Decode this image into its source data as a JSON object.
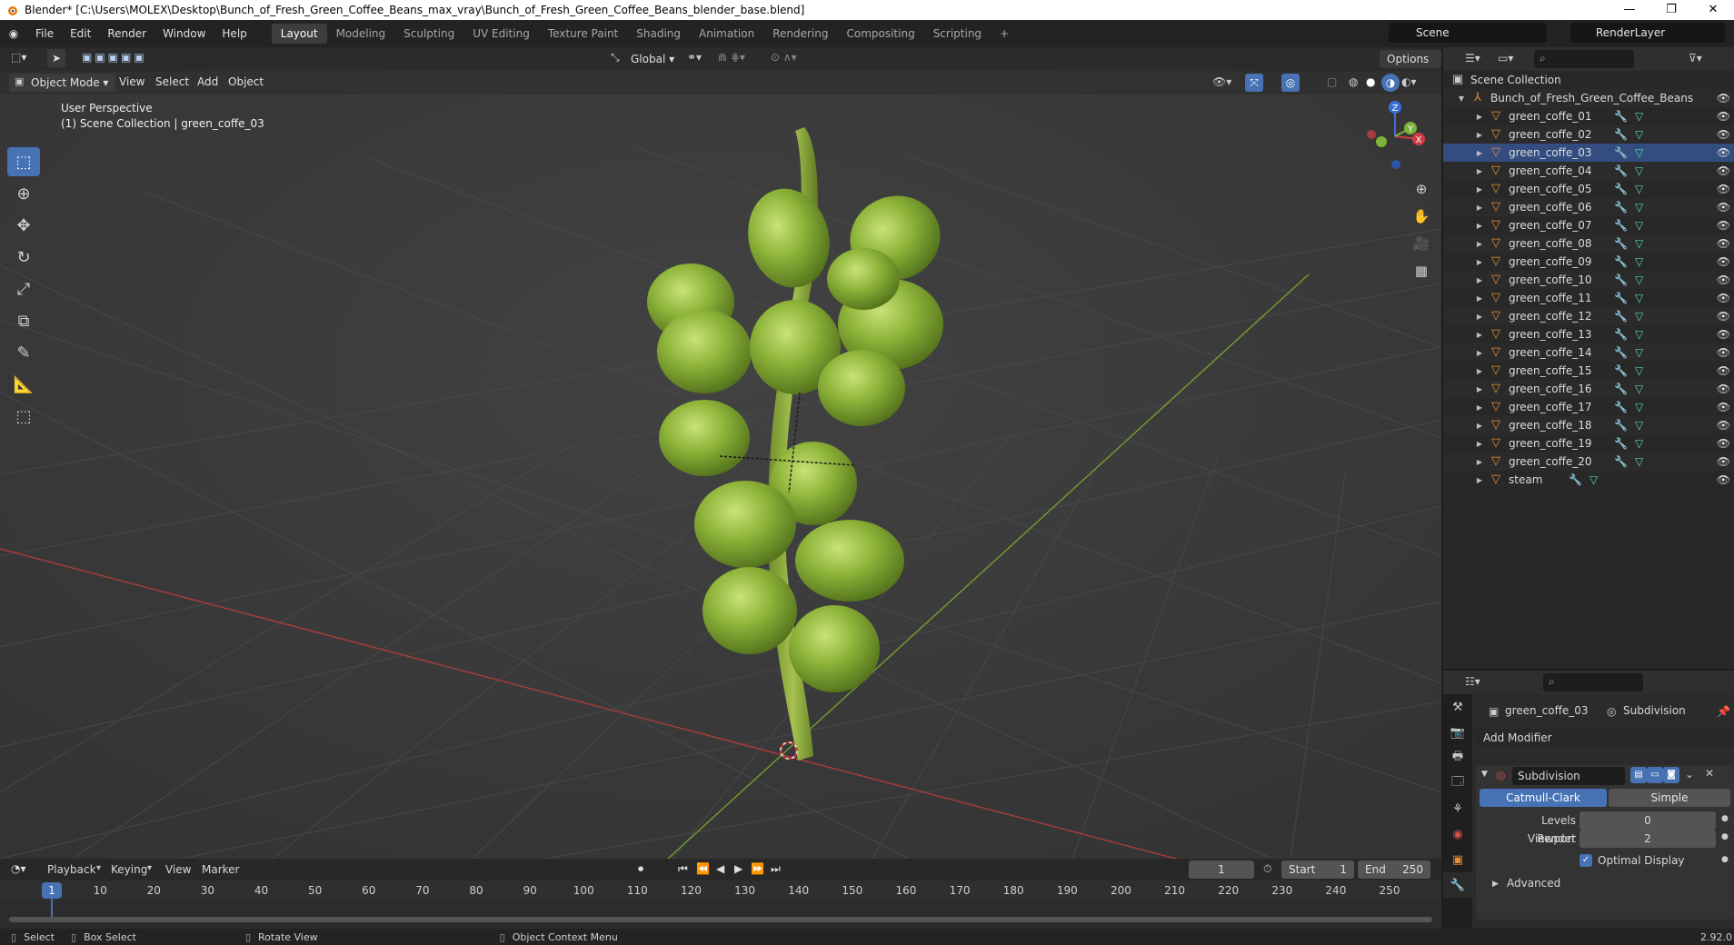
{
  "window": {
    "title": "Blender* [C:\\Users\\MOLEX\\Desktop\\Bunch_of_Fresh_Green_Coffee_Beans_max_vray\\Bunch_of_Fresh_Green_Coffee_Beans_blender_base.blend]",
    "controls": [
      "—",
      "❐",
      "✕"
    ]
  },
  "menu": [
    "File",
    "Edit",
    "Render",
    "Window",
    "Help"
  ],
  "workspaces": [
    "Layout",
    "Modeling",
    "Sculpting",
    "UV Editing",
    "Texture Paint",
    "Shading",
    "Animation",
    "Rendering",
    "Compositing",
    "Scripting"
  ],
  "active_workspace": "Layout",
  "scene": "Scene",
  "render_layer": "RenderLayer",
  "viewport": {
    "transform_orientation": "Global",
    "options_label": "Options",
    "mode": "Object Mode",
    "menus": [
      "View",
      "Select",
      "Add",
      "Object"
    ],
    "info_line1": "User Perspective",
    "info_line2": "(1) Scene Collection | green_coffe_03",
    "gizmo_axes": {
      "x": "X",
      "y": "Y",
      "z": "Z"
    }
  },
  "outliner": {
    "root": "Scene Collection",
    "collection": "Bunch_of_Fresh_Green_Coffee_Beans",
    "items": [
      "green_coffe_01",
      "green_coffe_02",
      "green_coffe_03",
      "green_coffe_04",
      "green_coffe_05",
      "green_coffe_06",
      "green_coffe_07",
      "green_coffe_08",
      "green_coffe_09",
      "green_coffe_10",
      "green_coffe_11",
      "green_coffe_12",
      "green_coffe_13",
      "green_coffe_14",
      "green_coffe_15",
      "green_coffe_16",
      "green_coffe_17",
      "green_coffe_18",
      "green_coffe_19",
      "green_coffe_20",
      "steam"
    ],
    "selected": "green_coffe_03"
  },
  "properties": {
    "object_name": "green_coffe_03",
    "modifier_breadcrumb": "Subdivision",
    "add_modifier": "Add Modifier",
    "modifier_name": "Subdivision",
    "subdiv_types": [
      "Catmull-Clark",
      "Simple"
    ],
    "active_subdiv_type": "Catmull-Clark",
    "levels_viewport_label": "Levels Viewport",
    "levels_viewport": "0",
    "render_label": "Render",
    "render_value": "2",
    "optimal_display_label": "Optimal Display",
    "optimal_display": true,
    "advanced_label": "Advanced"
  },
  "timeline": {
    "menus": [
      "Playback",
      "Keying",
      "View",
      "Marker"
    ],
    "current_frame": "1",
    "start_label": "Start",
    "start": "1",
    "end_label": "End",
    "end": "250",
    "ticks": [
      "1",
      "10",
      "20",
      "30",
      "40",
      "50",
      "60",
      "70",
      "80",
      "90",
      "100",
      "110",
      "120",
      "130",
      "140",
      "150",
      "160",
      "170",
      "180",
      "190",
      "200",
      "210",
      "220",
      "230",
      "240",
      "250"
    ]
  },
  "statusbar": {
    "select": "Select",
    "box_select": "Box Select",
    "rotate_view": "Rotate View",
    "context_menu": "Object Context Menu",
    "version": "2.92.0"
  }
}
